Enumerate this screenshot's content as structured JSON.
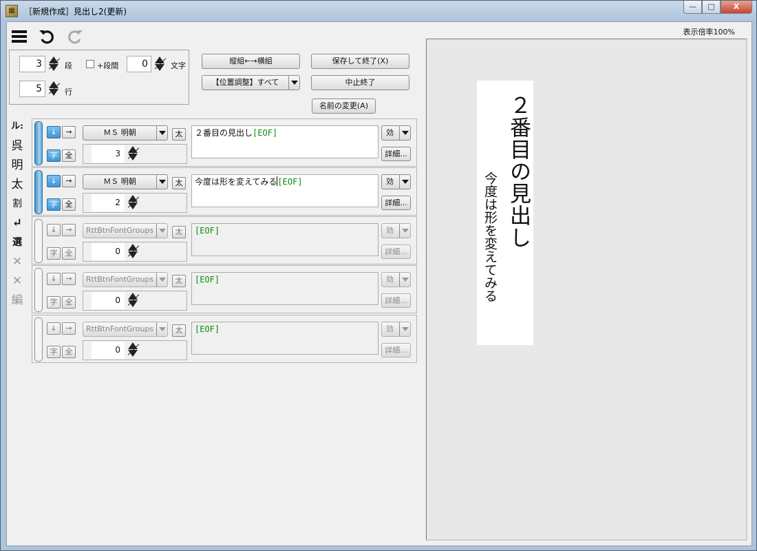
{
  "window": {
    "title": "［新規作成］見出し2(更新)",
    "app_icon": "app-icon",
    "controls": {
      "minimize": "—",
      "maximize": "□",
      "close": "X"
    }
  },
  "toolbar": {
    "zoom_label": "表示倍率100%"
  },
  "settings": {
    "columns_value": "3",
    "columns_label": "段",
    "plus_gap_label": "+段間",
    "chars_value": "0",
    "chars_label": "文字",
    "lines_value": "5",
    "lines_label": "行"
  },
  "actions": {
    "toggle_orientation": "縦組←→横組",
    "position_adjust": "【位置調整】すべて",
    "save_exit": "保存して終了(X)",
    "cancel_exit": "中止終了",
    "rename": "名前の変更(A)"
  },
  "tool_strip": [
    "ル:",
    "呉",
    "明",
    "太",
    "割",
    "↵",
    "選",
    "✕",
    "✕",
    "編"
  ],
  "rows": [
    {
      "active": true,
      "down_arrow": "↓",
      "right_arrow": "→",
      "font": "ＭＳ 明朝",
      "bold": "太",
      "char_btn": "字",
      "all_btn": "全",
      "size": "3",
      "text": "２番目の見出し",
      "eof": "[EOF]",
      "effect": "効",
      "detail": "詳細..."
    },
    {
      "active": true,
      "down_arrow": "↓",
      "right_arrow": "→",
      "font": "ＭＳ 明朝",
      "bold": "太",
      "char_btn": "字",
      "all_btn": "全",
      "size": "2",
      "text": "今度は形を変えてみる",
      "eof": "[EOF]",
      "effect": "効",
      "detail": "詳細..."
    },
    {
      "active": false,
      "down_arrow": "↓",
      "right_arrow": "→",
      "font": "RttBtnFontGroups",
      "bold": "太",
      "char_btn": "字",
      "all_btn": "全",
      "size": "0",
      "text": "",
      "eof": "[EOF]",
      "effect": "効",
      "detail": "詳細..."
    },
    {
      "active": false,
      "down_arrow": "↓",
      "right_arrow": "→",
      "font": "RttBtnFontGroups",
      "bold": "太",
      "char_btn": "字",
      "all_btn": "全",
      "size": "0",
      "text": "",
      "eof": "[EOF]",
      "effect": "効",
      "detail": "詳細..."
    },
    {
      "active": false,
      "down_arrow": "↓",
      "right_arrow": "→",
      "font": "RttBtnFontGroups",
      "bold": "太",
      "char_btn": "字",
      "all_btn": "全",
      "size": "0",
      "text": "",
      "eof": "[EOF]",
      "effect": "効",
      "detail": "詳細..."
    }
  ],
  "preview": {
    "main_text": "２番目の見出し",
    "sub_text": "今度は形を変えてみる"
  }
}
